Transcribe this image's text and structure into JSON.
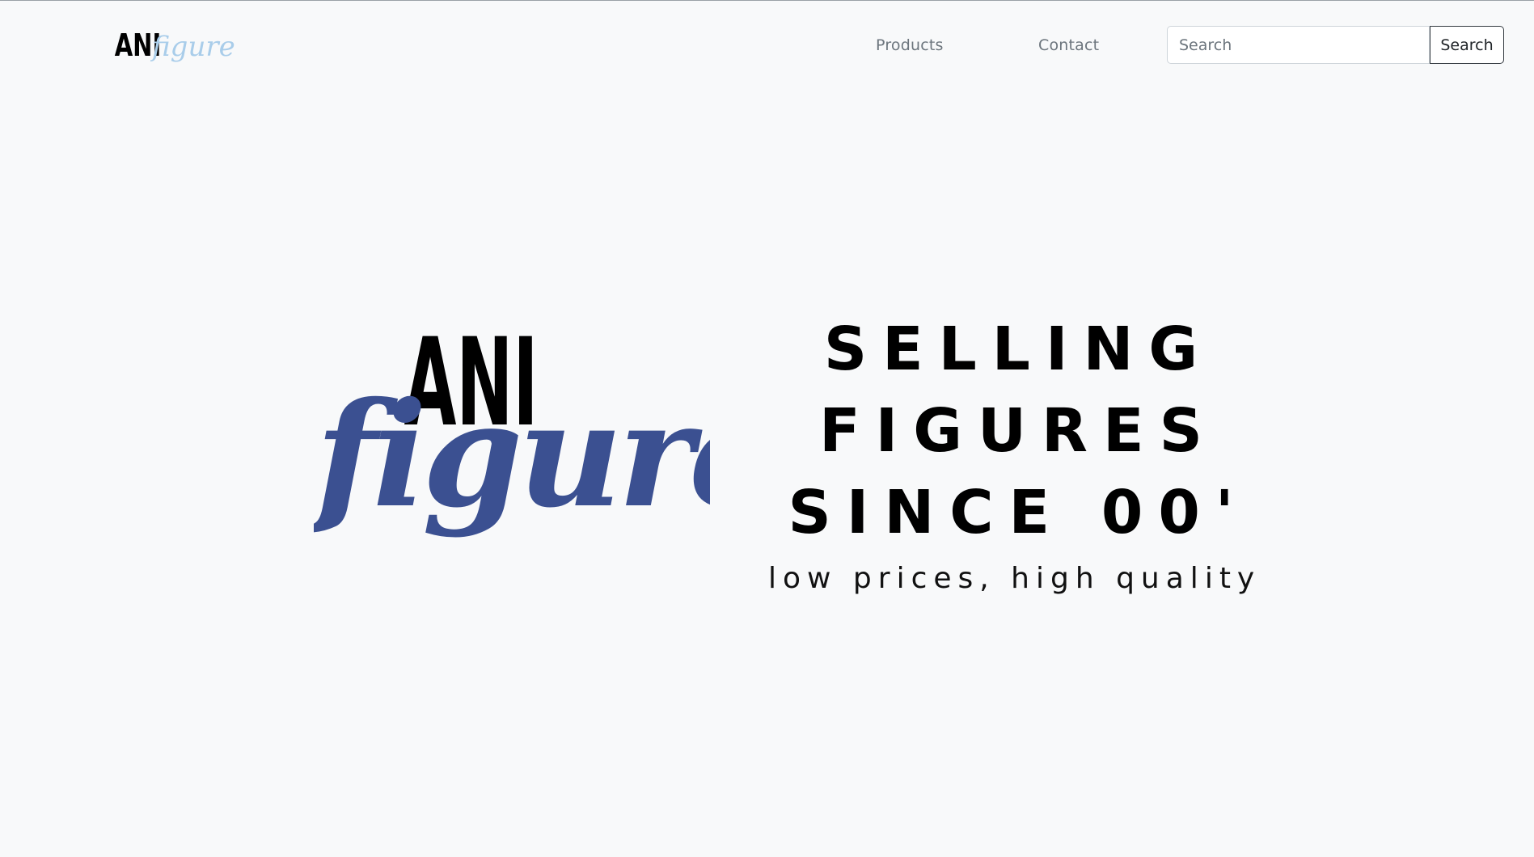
{
  "navbar": {
    "brand": {
      "word_top": "ANI",
      "word_script": "figures",
      "word_top_color": "#000000",
      "word_script_color": "#a9cdea"
    },
    "links": [
      {
        "label": "Products"
      },
      {
        "label": "Contact"
      }
    ],
    "search": {
      "placeholder": "Search",
      "value": "",
      "button_label": "Search"
    }
  },
  "hero": {
    "logo": {
      "word_top": "ANI",
      "word_script": "figures",
      "word_top_color": "#000000",
      "word_script_color": "#3b5091"
    },
    "headline": [
      "SELLING",
      "FIGURES",
      "SINCE 00'"
    ],
    "tagline": "low prices, high quality"
  },
  "colors": {
    "background": "#f8f9fa",
    "nav_link": "#6c757d",
    "search_button_border": "#343a40"
  }
}
